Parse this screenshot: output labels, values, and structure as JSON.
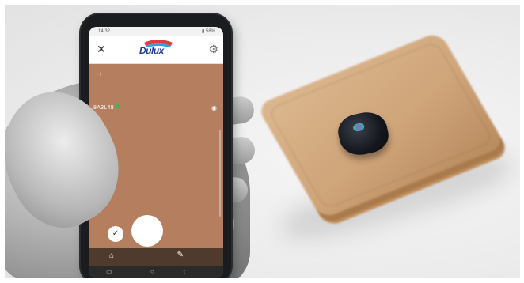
{
  "phone": {
    "status_time": "14:32",
    "status_icons": "▮ 58%",
    "brand": "Dulux",
    "color_code": "8A3L48",
    "color_name": "",
    "top_label": "• ‖"
  },
  "icons": {
    "close": "close-icon",
    "settings": "gear-icon",
    "eye": "eye-icon",
    "check": "check-icon",
    "home": "home-icon",
    "brush": "brush-icon"
  },
  "colors": {
    "swatch": "#b47e5f",
    "tabbar": "#4f3a2e",
    "brand_blue": "#1f3d8a",
    "wallet": "#cfa57a"
  }
}
